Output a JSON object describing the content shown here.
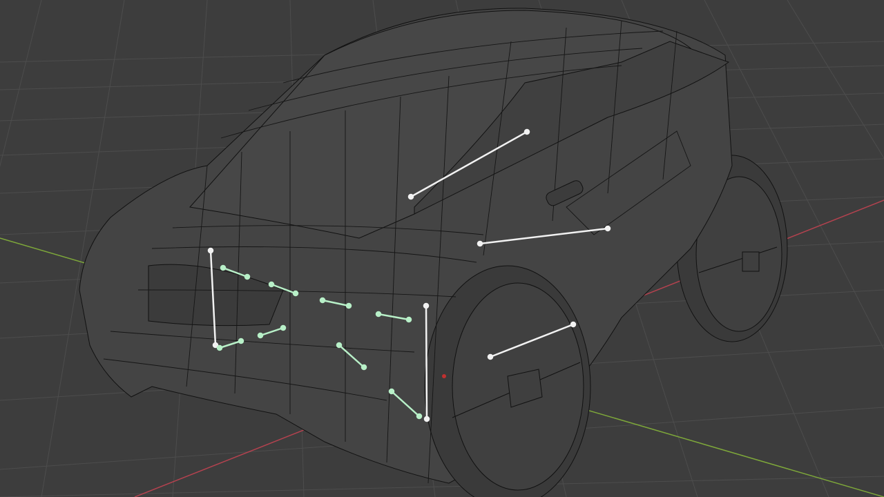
{
  "viewport": {
    "background": "#3d3d3d",
    "grid_color": "#4a4a4a",
    "axis_x_color": "#b4424f",
    "axis_y_color": "#7ea83a"
  },
  "model": {
    "fill": "#444444",
    "wire_color": "#111111",
    "wheel_fill": "#3a3a3a",
    "rig_line_white": "#f2f2f2",
    "rig_line_green": "#b8f0c8"
  }
}
